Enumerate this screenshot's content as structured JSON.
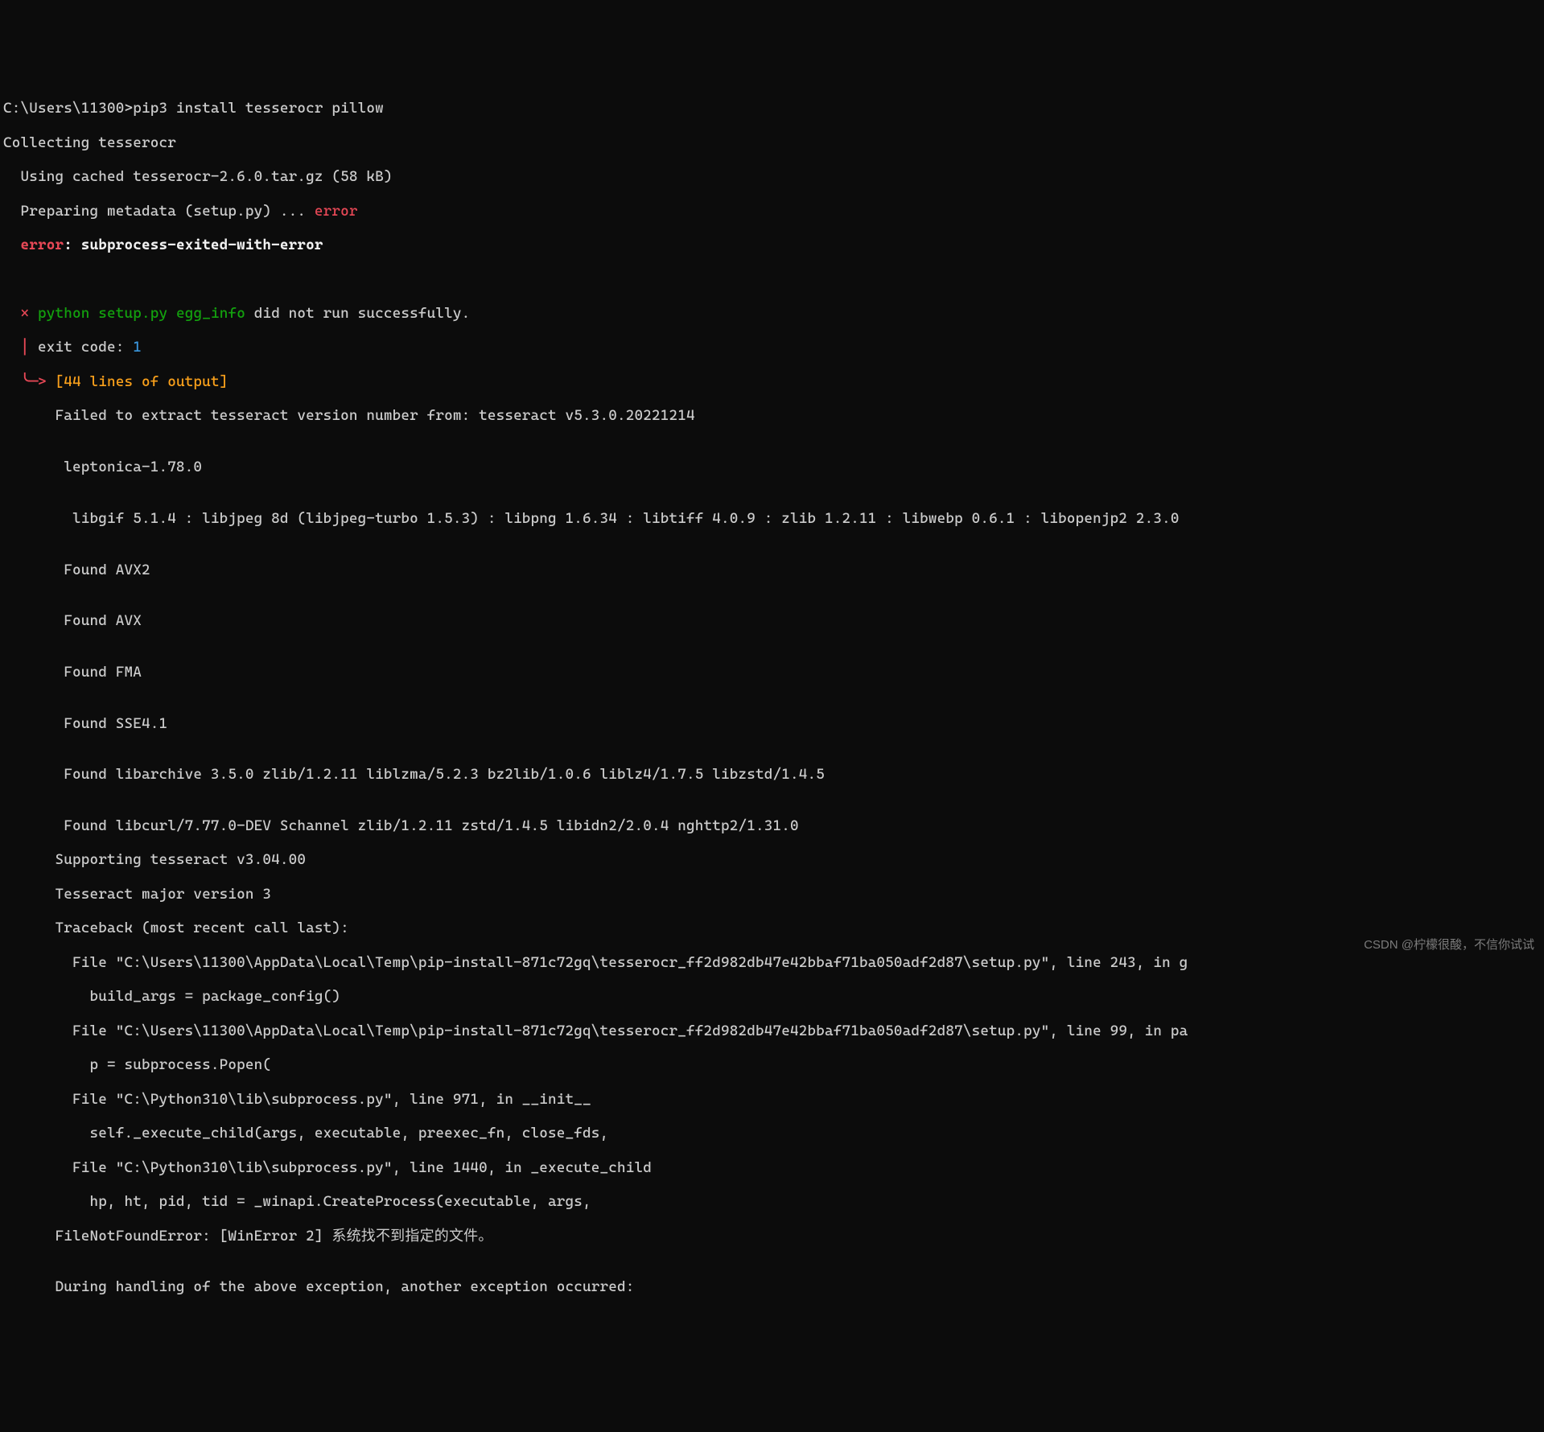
{
  "prompt": "C:\\Users\\11300>",
  "command": "pip3 install tesserocr pillow",
  "lines": {
    "collecting": "Collecting tesserocr",
    "using_cached": "  Using cached tesserocr-2.6.0.tar.gz (58 kB)",
    "preparing": "  Preparing metadata (setup.py) ... ",
    "error_word": "error",
    "error_label": "  error",
    "error_colon": ": ",
    "error_msg": "subprocess-exited-with-error",
    "cross": "  × ",
    "python": "python ",
    "setup": "setup.py ",
    "egginfo": "egg_info",
    "did_not_run": " did not run successfully.",
    "pipe": "  │ ",
    "exit_code_label": "exit code: ",
    "exit_code_val": "1",
    "arrow": "  ╰─> ",
    "lines_of_output": "[44 lines of output]",
    "out01": "      Failed to extract tesseract version number from: tesseract v5.3.0.20221214",
    "out02": "",
    "out03": "       leptonica-1.78.0",
    "out04": "",
    "out05": "        libgif 5.1.4 : libjpeg 8d (libjpeg-turbo 1.5.3) : libpng 1.6.34 : libtiff 4.0.9 : zlib 1.2.11 : libwebp 0.6.1 : libopenjp2 2.3.0",
    "out06": "",
    "out07": "       Found AVX2",
    "out08": "",
    "out09": "       Found AVX",
    "out10": "",
    "out11": "       Found FMA",
    "out12": "",
    "out13": "       Found SSE4.1",
    "out14": "",
    "out15": "       Found libarchive 3.5.0 zlib/1.2.11 liblzma/5.2.3 bz2lib/1.0.6 liblz4/1.7.5 libzstd/1.4.5",
    "out16": "",
    "out17": "       Found libcurl/7.77.0-DEV Schannel zlib/1.2.11 zstd/1.4.5 libidn2/2.0.4 nghttp2/1.31.0",
    "out18": "      Supporting tesseract v3.04.00",
    "out19": "      Tesseract major version 3",
    "out20": "      Traceback (most recent call last):",
    "out21": "        File \"C:\\Users\\11300\\AppData\\Local\\Temp\\pip-install-871c72gq\\tesserocr_ff2d982db47e42bbaf71ba050adf2d87\\setup.py\", line 243, in g",
    "out22": "          build_args = package_config()",
    "out23": "        File \"C:\\Users\\11300\\AppData\\Local\\Temp\\pip-install-871c72gq\\tesserocr_ff2d982db47e42bbaf71ba050adf2d87\\setup.py\", line 99, in pa",
    "out24": "          p = subprocess.Popen(",
    "out25": "        File \"C:\\Python310\\lib\\subprocess.py\", line 971, in __init__",
    "out26": "          self._execute_child(args, executable, preexec_fn, close_fds,",
    "out27": "        File \"C:\\Python310\\lib\\subprocess.py\", line 1440, in _execute_child",
    "out28": "          hp, ht, pid, tid = _winapi.CreateProcess(executable, args,",
    "out29": "      FileNotFoundError: [WinError 2] 系统找不到指定的文件。",
    "out30": "",
    "out31": "      During handling of the above exception, another exception occurred:"
  },
  "watermark": "CSDN @柠檬很酸，不信你试试"
}
